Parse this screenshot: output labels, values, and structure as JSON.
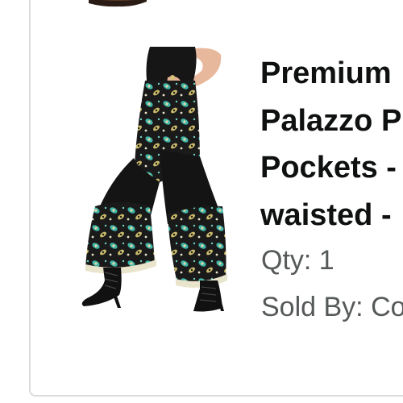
{
  "item": {
    "title_lines": [
      "Premium",
      "Palazzo P",
      "Pockets -",
      "waisted -"
    ],
    "quantity": "Qty: 1",
    "sold_by": "Sold By: Co",
    "image_icon": "product-photo-palazzo-pants"
  },
  "colors": {
    "title_text": "#0f1111",
    "secondary_text": "#565959",
    "card_border": "#d9dcdc"
  }
}
